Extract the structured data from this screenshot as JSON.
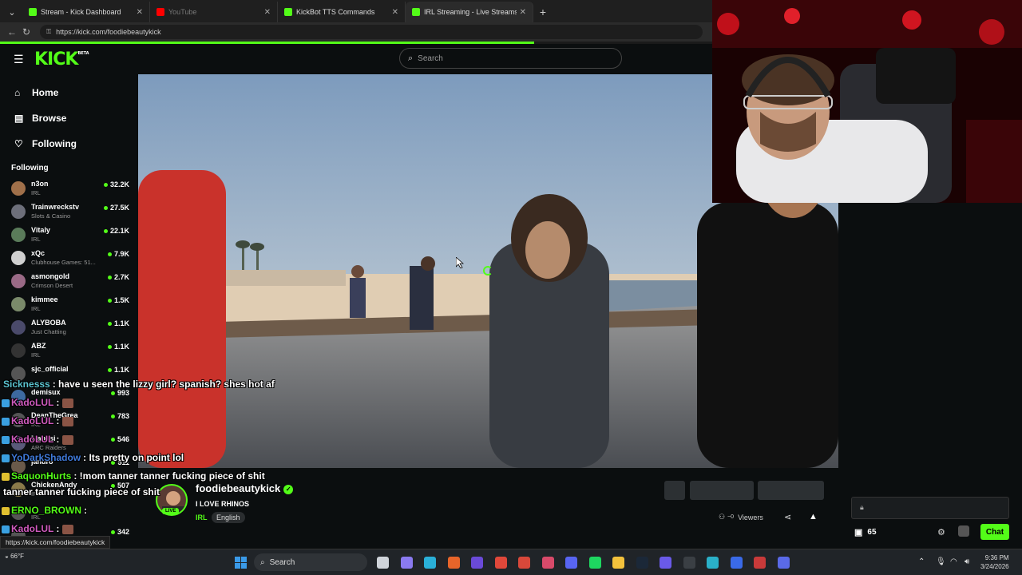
{
  "browser": {
    "tabs": [
      {
        "title": "Stream - Kick Dashboard",
        "active": false,
        "dim": false,
        "fav_color": "#53fc18"
      },
      {
        "title": "YouTube",
        "active": false,
        "dim": true,
        "fav_color": "#ff0000"
      },
      {
        "title": "KickBot TTS Commands",
        "active": false,
        "dim": false,
        "fav_color": "#53fc18"
      },
      {
        "title": "IRL Streaming - Live Streams on Ki",
        "active": true,
        "dim": false,
        "fav_color": "#53fc18"
      }
    ],
    "url": "https://kick.com/foodiebeautykick",
    "load_progress": 0.75
  },
  "kick": {
    "logo": "KICK",
    "logo_tag": "BETA",
    "search_placeholder": "Search",
    "nav": [
      {
        "label": "Home",
        "icon": "home-icon",
        "glyph": "⌂"
      },
      {
        "label": "Browse",
        "icon": "browse-icon",
        "glyph": "▤"
      },
      {
        "label": "Following",
        "icon": "heart-icon",
        "glyph": "♡"
      }
    ],
    "following_header": "Following",
    "channels": [
      {
        "name": "n3on",
        "category": "IRL",
        "viewers": "32.2K",
        "color": "#a0704a"
      },
      {
        "name": "Trainwreckstv",
        "category": "Slots & Casino",
        "viewers": "27.5K",
        "color": "#6d6f7a"
      },
      {
        "name": "Vitaly",
        "category": "IRL",
        "viewers": "22.1K",
        "color": "#5a7b5a"
      },
      {
        "name": "xQc",
        "category": "Clubhouse Games: 51...",
        "viewers": "7.9K",
        "color": "#d0d0d0"
      },
      {
        "name": "asmongold",
        "category": "Crimson Desert",
        "viewers": "2.7K",
        "color": "#9a6a86"
      },
      {
        "name": "kimmee",
        "category": "IRL",
        "viewers": "1.5K",
        "color": "#7a8a6a"
      },
      {
        "name": "ALYBOBA",
        "category": "Just Chatting",
        "viewers": "1.1K",
        "color": "#4a4a6a"
      },
      {
        "name": "ABZ",
        "category": "IRL",
        "viewers": "1.1K",
        "color": "#333"
      },
      {
        "name": "sjc_official",
        "category": "",
        "viewers": "1.1K",
        "color": "#555"
      },
      {
        "name": "demisux",
        "category": "",
        "viewers": "993",
        "color": "#3d6aa0"
      },
      {
        "name": "DeanTheGrea",
        "category": "IRL",
        "viewers": "783",
        "color": "#555"
      },
      {
        "name": "Mabasi",
        "category": "ARC Raiders",
        "viewers": "546",
        "color": "#5a5a7a"
      },
      {
        "name": "jandro",
        "category": "",
        "viewers": "511",
        "color": "#6a5a4a"
      },
      {
        "name": "ChickenAndy",
        "category": "IRL",
        "viewers": "507",
        "color": "#8a7a4a"
      },
      {
        "name": "",
        "category": "IRL",
        "viewers": "",
        "color": "#555"
      },
      {
        "name": "",
        "category": "",
        "viewers": "342",
        "color": "#555"
      }
    ]
  },
  "stream": {
    "streamer": "foodiebeautykick",
    "live_label": "LIVE",
    "title": "I LOVE RHINOS",
    "category": "IRL",
    "language": "English",
    "viewers_label": "Viewers",
    "viewers_count": "~0"
  },
  "chat": {
    "points": "65",
    "send_label": "Chat"
  },
  "overlay_chat": [
    {
      "user": "Sicknesss",
      "user_color": "#5bc4d0",
      "text": ": have u seen the lizzy girl? spanish? shes hot af",
      "badge": ""
    },
    {
      "user": "KadoLUL",
      "user_color": "#d05bbf",
      "text": ":",
      "badge": "#3aa0e0",
      "emote": true
    },
    {
      "user": "KadoLUL",
      "user_color": "#d05bbf",
      "text": ":",
      "badge": "#3aa0e0",
      "emote": true
    },
    {
      "user": "KadoLUL",
      "user_color": "#d05bbf",
      "text": ":",
      "badge": "#3aa0e0",
      "emote": true
    },
    {
      "user": "YoDarkShadow",
      "user_color": "#3f7ad9",
      "text": ": Its pretty on point lol",
      "badge": "#3aa0e0"
    },
    {
      "user": "SaquonHurts",
      "user_color": "#53fc18",
      "text": ": !mom tanner tanner fucking piece of shit",
      "badge": "#e0c030"
    },
    {
      "user": "",
      "user_color": "#fff",
      "text": "tanner tanner fucking piece of shit",
      "badge": ""
    },
    {
      "user": "ERNO_BROWN",
      "user_color": "#53fc18",
      "text": ":",
      "badge": "#e0c030"
    },
    {
      "user": "KadoLUL",
      "user_color": "#d05bbf",
      "text": ":",
      "badge": "#3aa0e0",
      "emote": true
    },
    {
      "user": "KadoLUL",
      "user_color": "#d05bbf",
      "text": ":",
      "badge": "#3aa0e0",
      "emote": true
    },
    {
      "user": "KadoLUL",
      "user_color": "#d05bbf",
      "text": ":",
      "badge": "#3aa0e0",
      "emote": true
    }
  ],
  "status_url": "https://kick.com/foodiebeautykick",
  "taskbar": {
    "weather": "66°F",
    "search_label": "Search",
    "time": "9:36 PM",
    "date": "3/24/2026"
  }
}
